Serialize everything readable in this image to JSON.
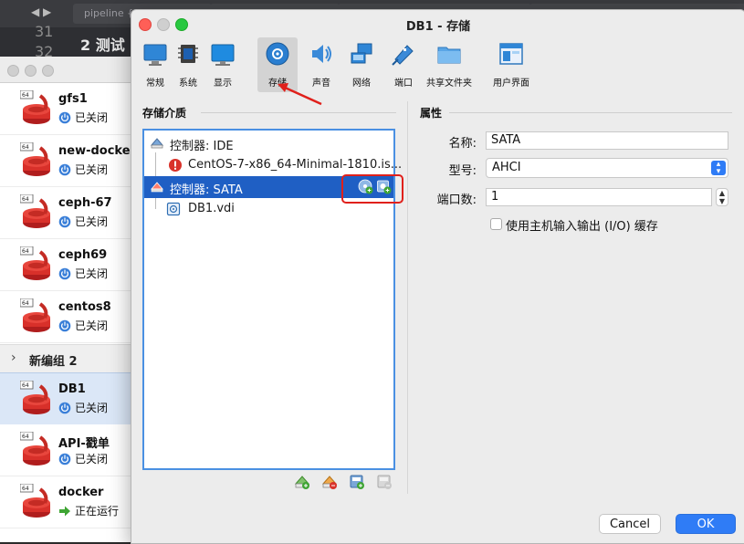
{
  "background_editor": {
    "tab_label": "pipeline {",
    "line_numbers": [
      "31",
      "32"
    ],
    "code_snippet": "2 测试"
  },
  "vm_list": {
    "vms": [
      {
        "name": "gfs1",
        "status": "已关闭"
      },
      {
        "name": "new-docker",
        "status": "已关闭"
      },
      {
        "name": "ceph-67",
        "status": "已关闭"
      },
      {
        "name": "ceph69",
        "status": "已关闭"
      },
      {
        "name": "centos8",
        "status": "已关闭"
      }
    ],
    "group_label": "新编组 2",
    "group_vms": [
      {
        "name": "DB1",
        "status": "已关闭"
      },
      {
        "name": "API-戳单",
        "status": "已关闭"
      },
      {
        "name": "docker",
        "status": "正在运行"
      }
    ],
    "badge": "64"
  },
  "dialog": {
    "title": "DB1 - 存储",
    "toolbar": [
      {
        "label": "常规",
        "icon": "monitor-icon"
      },
      {
        "label": "系统",
        "icon": "chip-icon"
      },
      {
        "label": "显示",
        "icon": "display-icon"
      },
      {
        "label": "存储",
        "icon": "disk-icon"
      },
      {
        "label": "声音",
        "icon": "speaker-icon"
      },
      {
        "label": "网络",
        "icon": "network-icon"
      },
      {
        "label": "端口",
        "icon": "port-icon"
      },
      {
        "label": "共享文件夹",
        "icon": "folder-icon"
      },
      {
        "label": "用户界面",
        "icon": "window-icon"
      }
    ],
    "selected_tool": "存储",
    "storage_title": "存储介质",
    "tree": {
      "ide_controller": "控制器: IDE",
      "ide_disc": "CentOS-7-x86_64-Minimal-1810.is...",
      "sata_controller": "控制器: SATA",
      "sata_disk": "DB1.vdi"
    },
    "attributes_title": "属性",
    "attributes": {
      "name_label": "名称:",
      "name_value": "SATA",
      "type_label": "型号:",
      "type_value": "AHCI",
      "ports_label": "端口数:",
      "ports_value": "1",
      "cache_label": "使用主机输入输出 (I/O) 缓存",
      "cache_checked": false
    },
    "buttons": {
      "cancel": "Cancel",
      "ok": "OK"
    }
  },
  "colors": {
    "selection": "#1f5fc4",
    "accent": "#2f7cf6",
    "highlight_box": "#e0201b"
  }
}
